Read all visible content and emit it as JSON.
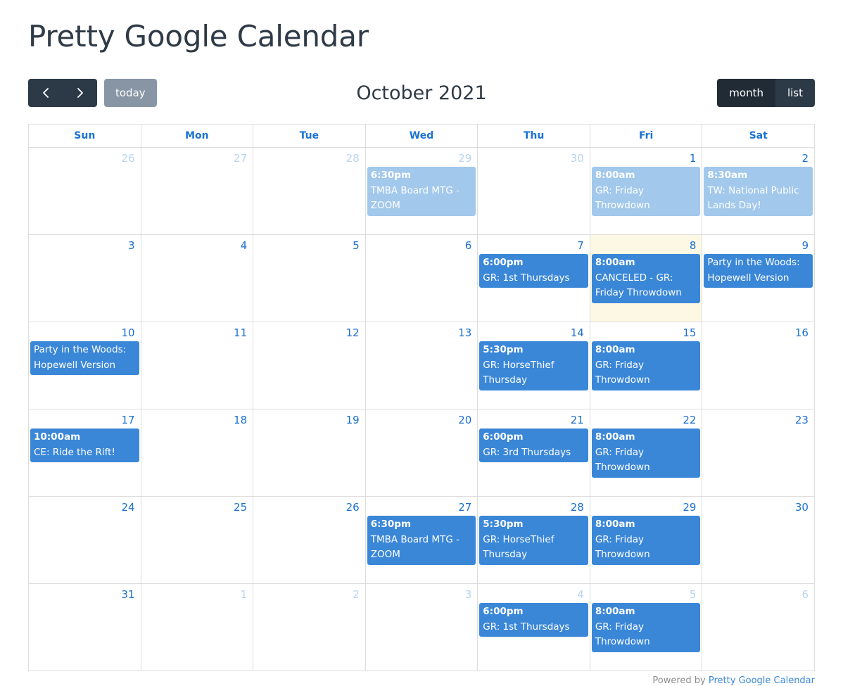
{
  "page_title": "Pretty Google Calendar",
  "toolbar": {
    "prev_label": "‹",
    "next_label": "›",
    "today_label": "today",
    "title": "October 2021",
    "month_label": "month",
    "list_label": "list"
  },
  "colors": {
    "accent_blue": "#3a87d8",
    "past_event_blue": "#a2c8ec",
    "today_bg": "#fcf8e3",
    "dark_button": "#2c3947",
    "active_button": "#212b36",
    "today_button": "#8795a4",
    "daynum_blue": "#1a6fd0",
    "other_month_blue": "#b9d4f0",
    "grid_border": "#dddddd",
    "title_text": "#2e3a46"
  },
  "day_headers": [
    "Sun",
    "Mon",
    "Tue",
    "Wed",
    "Thu",
    "Fri",
    "Sat"
  ],
  "weeks": [
    [
      {
        "num": "26",
        "other": true,
        "today": false,
        "events": []
      },
      {
        "num": "27",
        "other": true,
        "today": false,
        "events": []
      },
      {
        "num": "28",
        "other": true,
        "today": false,
        "events": []
      },
      {
        "num": "29",
        "other": true,
        "today": false,
        "events": [
          {
            "time": "6:30pm",
            "title": "TMBA Board MTG - ZOOM",
            "past": true
          }
        ]
      },
      {
        "num": "30",
        "other": true,
        "today": false,
        "events": []
      },
      {
        "num": "1",
        "other": false,
        "today": false,
        "events": [
          {
            "time": "8:00am",
            "title": "GR: Friday Throwdown",
            "past": true
          }
        ]
      },
      {
        "num": "2",
        "other": false,
        "today": false,
        "events": [
          {
            "time": "8:30am",
            "title": "TW: National Public Lands Day!",
            "past": true
          }
        ]
      }
    ],
    [
      {
        "num": "3",
        "other": false,
        "today": false,
        "events": []
      },
      {
        "num": "4",
        "other": false,
        "today": false,
        "events": []
      },
      {
        "num": "5",
        "other": false,
        "today": false,
        "events": []
      },
      {
        "num": "6",
        "other": false,
        "today": false,
        "events": []
      },
      {
        "num": "7",
        "other": false,
        "today": false,
        "events": [
          {
            "time": "6:00pm",
            "title": "GR: 1st Thursdays",
            "past": false
          }
        ]
      },
      {
        "num": "8",
        "other": false,
        "today": true,
        "events": [
          {
            "time": "8:00am",
            "title": "CANCELED - GR: Friday Throwdown",
            "past": false
          }
        ]
      },
      {
        "num": "9",
        "other": false,
        "today": false,
        "events": [
          {
            "time": "",
            "title": "Party in the Woods: Hopewell Version",
            "past": false
          }
        ]
      }
    ],
    [
      {
        "num": "10",
        "other": false,
        "today": false,
        "events": [
          {
            "time": "",
            "title": "Party in the Woods: Hopewell Version",
            "past": false
          }
        ]
      },
      {
        "num": "11",
        "other": false,
        "today": false,
        "events": []
      },
      {
        "num": "12",
        "other": false,
        "today": false,
        "events": []
      },
      {
        "num": "13",
        "other": false,
        "today": false,
        "events": []
      },
      {
        "num": "14",
        "other": false,
        "today": false,
        "events": [
          {
            "time": "5:30pm",
            "title": "GR: HorseThief Thursday",
            "past": false
          }
        ]
      },
      {
        "num": "15",
        "other": false,
        "today": false,
        "events": [
          {
            "time": "8:00am",
            "title": "GR: Friday Throwdown",
            "past": false
          }
        ]
      },
      {
        "num": "16",
        "other": false,
        "today": false,
        "events": []
      }
    ],
    [
      {
        "num": "17",
        "other": false,
        "today": false,
        "events": [
          {
            "time": "10:00am",
            "title": "CE: Ride the Rift!",
            "past": false
          }
        ]
      },
      {
        "num": "18",
        "other": false,
        "today": false,
        "events": []
      },
      {
        "num": "19",
        "other": false,
        "today": false,
        "events": []
      },
      {
        "num": "20",
        "other": false,
        "today": false,
        "events": []
      },
      {
        "num": "21",
        "other": false,
        "today": false,
        "events": [
          {
            "time": "6:00pm",
            "title": "GR: 3rd Thursdays",
            "past": false
          }
        ]
      },
      {
        "num": "22",
        "other": false,
        "today": false,
        "events": [
          {
            "time": "8:00am",
            "title": "GR: Friday Throwdown",
            "past": false
          }
        ]
      },
      {
        "num": "23",
        "other": false,
        "today": false,
        "events": []
      }
    ],
    [
      {
        "num": "24",
        "other": false,
        "today": false,
        "events": []
      },
      {
        "num": "25",
        "other": false,
        "today": false,
        "events": []
      },
      {
        "num": "26",
        "other": false,
        "today": false,
        "events": []
      },
      {
        "num": "27",
        "other": false,
        "today": false,
        "events": [
          {
            "time": "6:30pm",
            "title": "TMBA Board MTG - ZOOM",
            "past": false
          }
        ]
      },
      {
        "num": "28",
        "other": false,
        "today": false,
        "events": [
          {
            "time": "5:30pm",
            "title": "GR: HorseThief Thursday",
            "past": false
          }
        ]
      },
      {
        "num": "29",
        "other": false,
        "today": false,
        "events": [
          {
            "time": "8:00am",
            "title": "GR: Friday Throwdown",
            "past": false
          }
        ]
      },
      {
        "num": "30",
        "other": false,
        "today": false,
        "events": []
      }
    ],
    [
      {
        "num": "31",
        "other": false,
        "today": false,
        "events": []
      },
      {
        "num": "1",
        "other": true,
        "today": false,
        "events": []
      },
      {
        "num": "2",
        "other": true,
        "today": false,
        "events": []
      },
      {
        "num": "3",
        "other": true,
        "today": false,
        "events": []
      },
      {
        "num": "4",
        "other": true,
        "today": false,
        "events": [
          {
            "time": "6:00pm",
            "title": "GR: 1st Thursdays",
            "past": false
          }
        ]
      },
      {
        "num": "5",
        "other": true,
        "today": false,
        "events": [
          {
            "time": "8:00am",
            "title": "GR: Friday Throwdown",
            "past": false
          }
        ]
      },
      {
        "num": "6",
        "other": true,
        "today": false,
        "events": []
      }
    ]
  ],
  "footer": {
    "powered_by": "Powered by",
    "link_label": "Pretty Google Calendar"
  }
}
